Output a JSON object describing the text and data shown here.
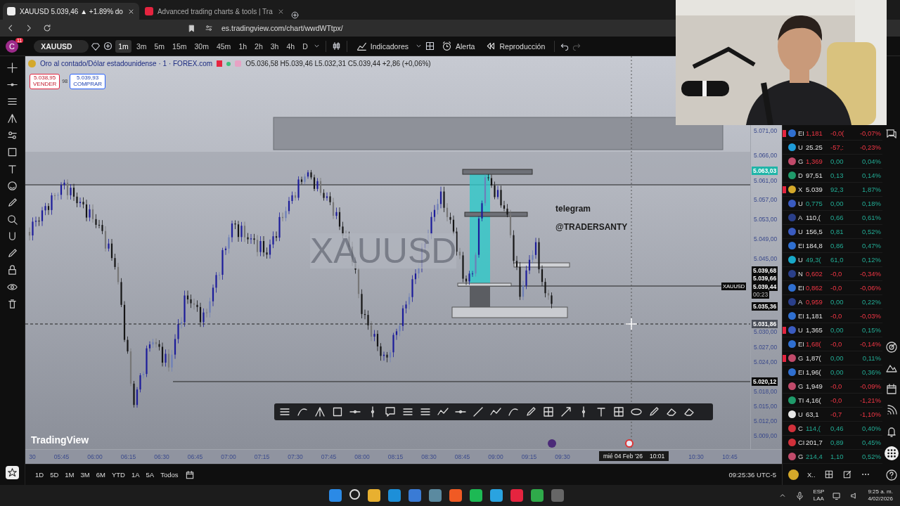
{
  "browser": {
    "tabs": [
      {
        "title": "XAUUSD 5.039,46 ▲ +1.89% do",
        "selected": true
      },
      {
        "title": "Advanced trading charts & tools | Tra",
        "selected": false
      }
    ],
    "url": "es.tradingview.com/chart/wwdWTtpx/"
  },
  "toolbar": {
    "avatar": "C",
    "badge": "11",
    "symbol": "XAUUSD",
    "intervals": [
      {
        "label": "1m",
        "selected": true
      },
      {
        "label": "3m",
        "selected": false
      },
      {
        "label": "5m",
        "selected": false
      },
      {
        "label": "15m",
        "selected": false
      },
      {
        "label": "30m",
        "selected": false
      },
      {
        "label": "45m",
        "selected": false
      },
      {
        "label": "1h",
        "selected": false
      },
      {
        "label": "2h",
        "selected": false
      },
      {
        "label": "3h",
        "selected": false
      },
      {
        "label": "4h",
        "selected": false
      },
      {
        "label": "D",
        "selected": false
      }
    ],
    "buttons": [
      {
        "kind": "indicators",
        "label": "Indicadores"
      },
      {
        "kind": "alert",
        "label": "Alerta"
      },
      {
        "kind": "replay",
        "label": "Reproducción"
      }
    ]
  },
  "legend": {
    "title": "Oro al contado/Dólar estadounidense · 1 · FOREX.com",
    "ohlc": "O5.036,58 H5.039,46 L5.032,31 C5.039,44 +2,86 (+0,06%)",
    "sell": {
      "price": "5.038,95",
      "label": "VENDER"
    },
    "spread": "98",
    "buy": {
      "price": "5.039,93",
      "label": "COMPRAR"
    }
  },
  "chart": {
    "watermark": "XAUUSD",
    "notes": [
      "telegram",
      "@TRADERSANTY"
    ],
    "logo": "TradingView",
    "symbol_tag": "XAUUSD",
    "price_ticks": [
      "5.071,00",
      "5.066,00",
      "5.061,00",
      "5.057,00",
      "5.053,00",
      "5.049,00",
      "5.045,00",
      "5.030,00",
      "5.027,00",
      "5.024,00",
      "5.018,00",
      "5.015,00",
      "5.012,00",
      "5.009,00"
    ],
    "price_markers": [
      {
        "text": "5.063,03",
        "kind": "high"
      },
      {
        "text": "5.039,68",
        "kind": "level"
      },
      {
        "text": "5.039,66",
        "kind": "level"
      },
      {
        "text": "5.039,44",
        "kind": "level"
      },
      {
        "text": "00:23",
        "kind": "countdown"
      },
      {
        "text": "5.035,36",
        "kind": "level"
      },
      {
        "text": "5.031,86",
        "kind": "cursor"
      },
      {
        "text": "5.020,12",
        "kind": "level"
      }
    ],
    "time_ticks": [
      "30",
      "05:45",
      "06:00",
      "06:15",
      "06:30",
      "06:45",
      "07:00",
      "07:15",
      "07:30",
      "07:45",
      "08:00",
      "08:15",
      "08:30",
      "08:45",
      "09:00",
      "09:15",
      "09:30"
    ],
    "time_ticks_right": [
      "10:30",
      "10:45"
    ],
    "cursor_date": "mié 04 Feb '26",
    "cursor_time": "10:01"
  },
  "ranges": [
    "1D",
    "5D",
    "1M",
    "3M",
    "6M",
    "YTD",
    "1A",
    "5A",
    "Todos"
  ],
  "clock": "09:25:36 UTC-5",
  "watchlist": {
    "rows": [
      {
        "flag": true,
        "symbol": "EI",
        "last": "1,181",
        "last_up": false,
        "last_down": true,
        "change": "-0,0(",
        "pct": "-0,07%",
        "change_down": true,
        "color": "#2f6fd0"
      },
      {
        "flag": false,
        "symbol": "U",
        "last": "25.25",
        "last_up": false,
        "last_down": false,
        "change": "-57,:",
        "pct": "-0,23%",
        "change_down": true,
        "color": "#1e9bd8"
      },
      {
        "flag": false,
        "symbol": "G",
        "last": "1,369",
        "last_up": false,
        "last_down": true,
        "change": "0,00",
        "pct": "0,04%",
        "change_down": false,
        "color": "#c04a6a"
      },
      {
        "flag": false,
        "symbol": "D",
        "last": "97,51",
        "last_up": false,
        "last_down": false,
        "change": "0,13",
        "pct": "0,14%",
        "change_down": false,
        "color": "#1f9a6a"
      },
      {
        "flag": true,
        "symbol": "X",
        "last": "5.039",
        "last_up": false,
        "last_down": false,
        "change": "92,3",
        "pct": "1,87%",
        "change_down": false,
        "color": "#d4a82a"
      },
      {
        "flag": false,
        "symbol": "U",
        "last": "0,775",
        "last_up": true,
        "last_down": false,
        "change": "0,00",
        "pct": "0,18%",
        "change_down": false,
        "color": "#3a5bc0"
      },
      {
        "flag": false,
        "symbol": "A",
        "last": "110,(",
        "last_up": false,
        "last_down": false,
        "change": "0,66",
        "pct": "0,61%",
        "change_down": false,
        "color": "#2a3f8a"
      },
      {
        "flag": false,
        "symbol": "U",
        "last": "156,5",
        "last_up": false,
        "last_down": false,
        "change": "0,81",
        "pct": "0,52%",
        "change_down": false,
        "color": "#3a5bc0"
      },
      {
        "flag": false,
        "symbol": "EI",
        "last": "184,8",
        "last_up": false,
        "last_down": false,
        "change": "0,86",
        "pct": "0,47%",
        "change_down": false,
        "color": "#2f6fd0"
      },
      {
        "flag": false,
        "symbol": "U",
        "last": "49,3(",
        "last_up": true,
        "last_down": false,
        "change": "61,0",
        "pct": "0,12%",
        "change_down": false,
        "color": "#18a8c8"
      },
      {
        "flag": false,
        "symbol": "N",
        "last": "0,602",
        "last_up": false,
        "last_down": true,
        "change": "-0,0",
        "pct": "-0,34%",
        "change_down": true,
        "color": "#2a3f8a"
      },
      {
        "flag": false,
        "symbol": "EI",
        "last": "0,862",
        "last_up": false,
        "last_down": true,
        "change": "-0,0",
        "pct": "-0,06%",
        "change_down": true,
        "color": "#2f6fd0"
      },
      {
        "flag": false,
        "symbol": "A",
        "last": "0,959",
        "last_up": false,
        "last_down": true,
        "change": "0,00",
        "pct": "0,22%",
        "change_down": false,
        "color": "#2a3f8a"
      },
      {
        "flag": false,
        "symbol": "EI",
        "last": "1,181",
        "last_up": false,
        "last_down": false,
        "change": "-0,0",
        "pct": "-0,03%",
        "change_down": true,
        "color": "#2f6fd0"
      },
      {
        "flag": true,
        "symbol": "U",
        "last": "1,365",
        "last_up": false,
        "last_down": false,
        "change": "0,00",
        "pct": "0,15%",
        "change_down": false,
        "color": "#3a5bc0"
      },
      {
        "flag": false,
        "symbol": "EI",
        "last": "1,68(",
        "last_up": false,
        "last_down": true,
        "change": "-0,0",
        "pct": "-0,14%",
        "change_down": true,
        "color": "#2f6fd0"
      },
      {
        "flag": true,
        "symbol": "G",
        "last": "1,87(",
        "last_up": false,
        "last_down": false,
        "change": "0,00",
        "pct": "0,11%",
        "change_down": false,
        "color": "#c04a6a"
      },
      {
        "flag": false,
        "symbol": "EI",
        "last": "1,96(",
        "last_up": false,
        "last_down": false,
        "change": "0,00",
        "pct": "0,36%",
        "change_down": false,
        "color": "#2f6fd0"
      },
      {
        "flag": false,
        "symbol": "G",
        "last": "1,949",
        "last_up": false,
        "last_down": false,
        "change": "-0,0",
        "pct": "-0,09%",
        "change_down": true,
        "color": "#c04a6a"
      },
      {
        "flag": false,
        "symbol": "TI",
        "last": "4,16(",
        "last_up": false,
        "last_down": false,
        "change": "-0,0",
        "pct": "-1,21%",
        "change_down": true,
        "color": "#1f9a6a"
      },
      {
        "flag": false,
        "symbol": "U",
        "last": "63,1",
        "last_up": false,
        "last_down": false,
        "change": "-0,7",
        "pct": "-1,10%",
        "change_down": true,
        "color": "#e8e8e8"
      },
      {
        "flag": false,
        "symbol": "C",
        "last": "114,(",
        "last_up": true,
        "last_down": false,
        "change": "0,46",
        "pct": "0,40%",
        "change_down": false,
        "color": "#d0303a"
      },
      {
        "flag": false,
        "symbol": "CI",
        "last": "201,7",
        "last_up": false,
        "last_down": false,
        "change": "0,89",
        "pct": "0,45%",
        "change_down": false,
        "color": "#d0303a"
      },
      {
        "flag": false,
        "symbol": "G",
        "last": "214,4",
        "last_up": true,
        "last_down": false,
        "change": "1,10",
        "pct": "0,52%",
        "change_down": false,
        "color": "#c04a6a"
      }
    ],
    "footer": "X.."
  },
  "taskbar": {
    "lang": "ESP",
    "layout": "LAA",
    "time": "9:25 a. m.",
    "date": "4/02/2026"
  }
}
